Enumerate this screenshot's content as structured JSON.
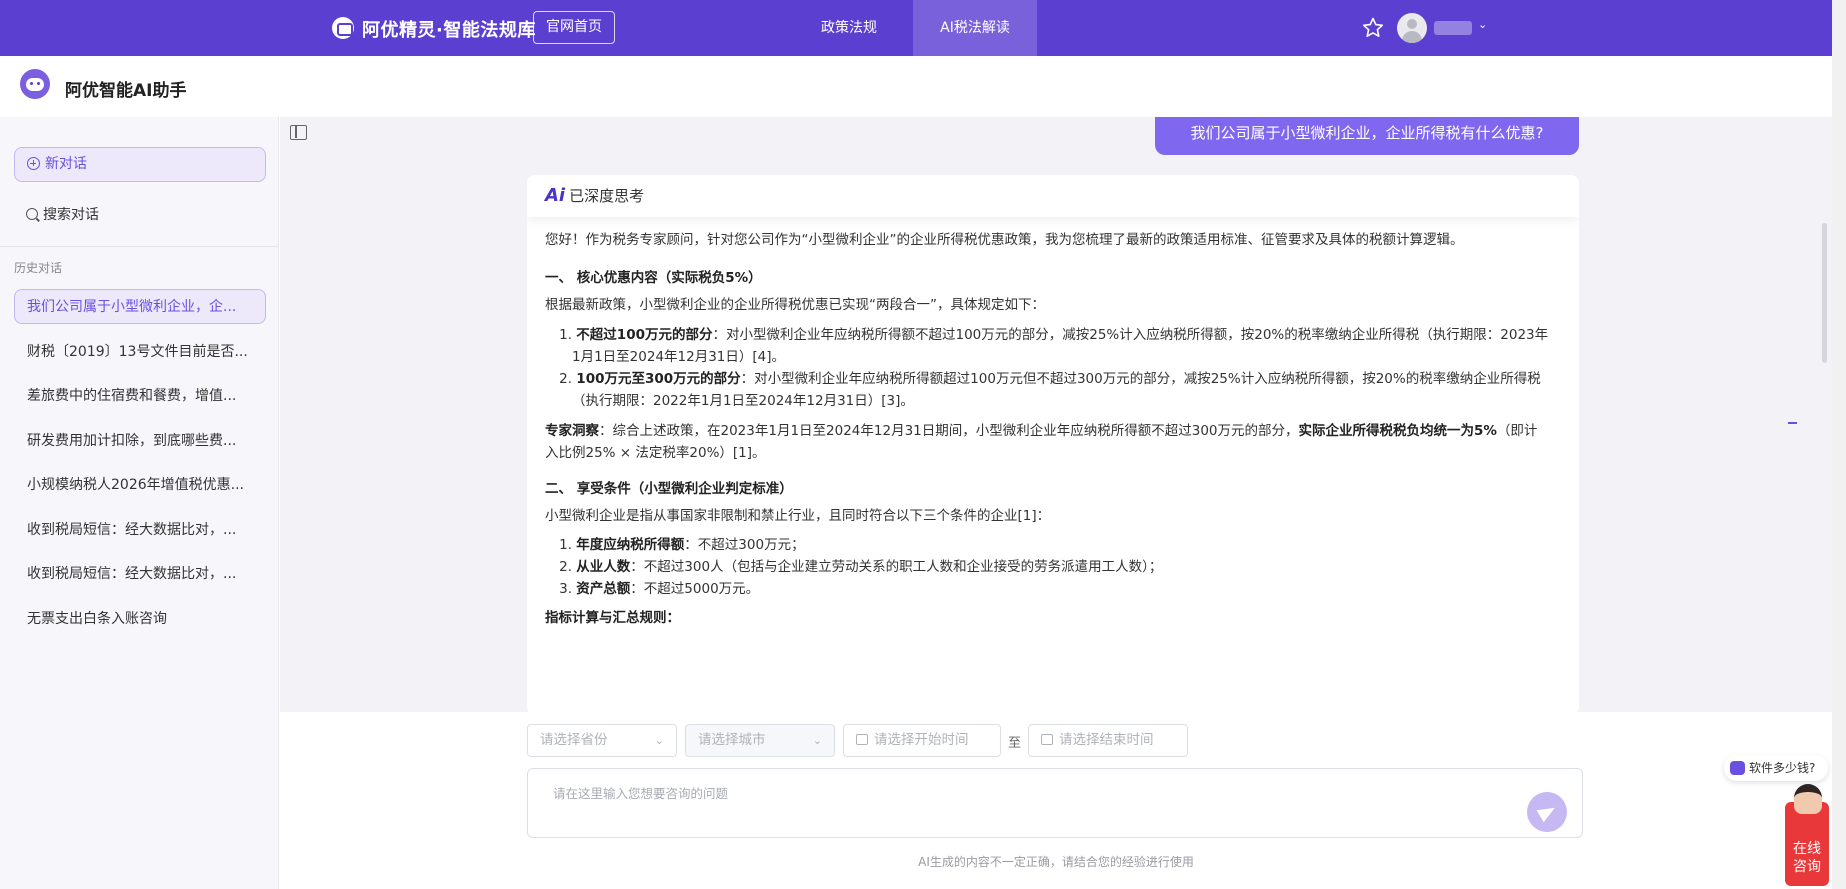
{
  "topnav": {
    "brand": "阿优精灵·智能法规库",
    "home_button": "官网首页",
    "tabs": [
      {
        "label": "政策法规"
      },
      {
        "label": "AI税法解读"
      }
    ]
  },
  "header": {
    "title": "阿优智能AI助手"
  },
  "sidebar": {
    "new_chat": "新对话",
    "search": "搜索对话",
    "history_label": "历史对话",
    "history": [
      "我们公司属于小型微利企业，企...",
      "财税〔2019〕13号文件目前是否...",
      "差旅费中的住宿费和餐费，增值...",
      "研发费用加计扣除，到底哪些费...",
      "小规模纳税人2026年增值税优惠...",
      "收到税局短信：经大数据比对，...",
      "收到税局短信：经大数据比对，...",
      "无票支出白条入账咨询"
    ]
  },
  "chat": {
    "user_question": "我们公司属于小型微利企业，企业所得税有什么优惠?",
    "thinking_status": "已深度思考",
    "ai_icon_text": "Ai",
    "intro": "您好！作为税务专家顾问，针对您公司作为“小型微利企业”的企业所得税优惠政策，我为您梳理了最新的政策适用标准、征管要求及具体的税额计算逻辑。",
    "section1_title": "一、 核心优惠内容（实际税负5%）",
    "section1_lead": "根据最新政策，小型微利企业的企业所得税优惠已实现“两段合一”，具体规定如下：",
    "section1_items": [
      {
        "num": "1.",
        "bold": "不超过100万元的部分",
        "line1": "：对小型微利企业年应纳税所得额不超过100万元的部分，减按25%计入应纳税所得额，按20%的税率缴纳企业所得税（执行期限：2023年",
        "line2": "1月1日至2024年12月31日）[4]。"
      },
      {
        "num": "2.",
        "bold": "100万元至300万元的部分",
        "line1": "：对小型微利企业年应纳税所得额超过100万元但不超过300万元的部分，减按25%计入应纳税所得额，按20%的税率缴纳企业所得税",
        "line2": "（执行期限：2022年1月1日至2024年12月31日）[3]。"
      }
    ],
    "insight_label": "专家洞察",
    "insight_text": "：综合上述政策，在2023年1月1日至2024年12月31日期间，小型微利企业年应纳税所得额不超过300万元的部分，",
    "insight_bold": "实际企业所得税税负均统一为5%",
    "insight_tail": "（即计",
    "insight_line2": "入比例25% × 法定税率20%）[1]。",
    "section2_title": "二、 享受条件（小型微利企业判定标准）",
    "section2_lead": "小型微利企业是指从事国家非限制和禁止行业，且同时符合以下三个条件的企业[1]：",
    "section2_items": [
      {
        "num": "1.",
        "bold": "年度应纳税所得额",
        "text": "：不超过300万元；"
      },
      {
        "num": "2.",
        "bold": "从业人数",
        "text": "：不超过300人（包括与企业建立劳动关系的职工人数和企业接受的劳务派遣用工人数）；"
      },
      {
        "num": "3.",
        "bold": "资产总额",
        "text": "：不超过5000万元。"
      }
    ],
    "section3_title": "指标计算与汇总规则："
  },
  "input": {
    "province_placeholder": "请选择省份",
    "city_placeholder": "请选择城市",
    "start_placeholder": "请选择开始时间",
    "range_separator": "至",
    "end_placeholder": "请选择结束时间",
    "question_placeholder": "请在这里输入您想要咨询的问题",
    "disclaimer": "AI生成的内容不一定正确，请结合您的经验进行使用"
  },
  "widgets": {
    "price_chip": "软件多少钱?",
    "consult_line1": "在线",
    "consult_line2": "咨询"
  },
  "colors": {
    "nav_bg": "#5b3fd1",
    "accent": "#7f67f0",
    "consult_red": "#e8383a"
  }
}
